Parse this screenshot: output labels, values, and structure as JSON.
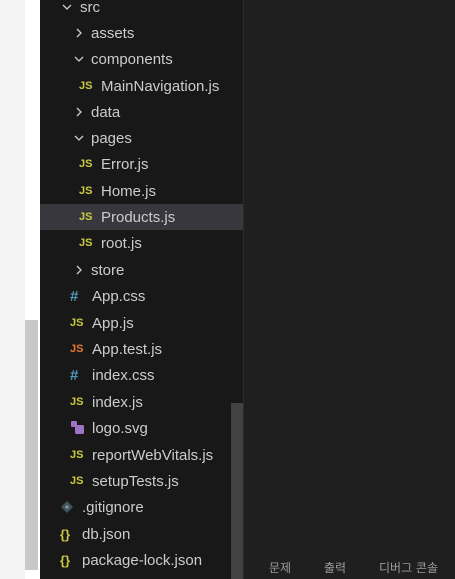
{
  "explorer": {
    "items": [
      {
        "label": "src",
        "type": "folder",
        "expanded": true,
        "icon": "chevron-down-icon"
      },
      {
        "label": "assets",
        "type": "folder",
        "expanded": false,
        "icon": "chevron-right-icon"
      },
      {
        "label": "components",
        "type": "folder",
        "expanded": true,
        "icon": "chevron-down-icon"
      },
      {
        "label": "MainNavigation.js",
        "type": "file",
        "icon_text": "JS"
      },
      {
        "label": "data",
        "type": "folder",
        "expanded": false,
        "icon": "chevron-right-icon"
      },
      {
        "label": "pages",
        "type": "folder",
        "expanded": true,
        "icon": "chevron-down-icon"
      },
      {
        "label": "Error.js",
        "type": "file",
        "icon_text": "JS"
      },
      {
        "label": "Home.js",
        "type": "file",
        "icon_text": "JS"
      },
      {
        "label": "Products.js",
        "type": "file",
        "icon_text": "JS",
        "selected": true
      },
      {
        "label": "root.js",
        "type": "file",
        "icon_text": "JS"
      },
      {
        "label": "store",
        "type": "folder",
        "expanded": false,
        "icon": "chevron-right-icon"
      },
      {
        "label": "App.css",
        "type": "file",
        "icon_text": "#"
      },
      {
        "label": "App.js",
        "type": "file",
        "icon_text": "JS"
      },
      {
        "label": "App.test.js",
        "type": "file",
        "icon_text": "JS"
      },
      {
        "label": "index.css",
        "type": "file",
        "icon_text": "#"
      },
      {
        "label": "index.js",
        "type": "file",
        "icon_text": "JS"
      },
      {
        "label": "logo.svg",
        "type": "file",
        "icon": "svg-file-icon"
      },
      {
        "label": "reportWebVitals.js",
        "type": "file",
        "icon_text": "JS"
      },
      {
        "label": "setupTests.js",
        "type": "file",
        "icon_text": "JS"
      },
      {
        "label": ".gitignore",
        "type": "file",
        "icon": "git-diamond-icon"
      },
      {
        "label": "db.json",
        "type": "file",
        "icon_text": "{}"
      },
      {
        "label": "package-lock.json",
        "type": "file",
        "icon_text": "{}"
      }
    ]
  },
  "panel": {
    "tabs": [
      "문제",
      "출력",
      "디버그 콘솔"
    ]
  },
  "colors": {
    "explorer_bg": "#181818",
    "editor_bg": "#1f1f1f",
    "selected_row": "#37373d",
    "js_icon": "#cbcb41",
    "test_icon": "#e37933",
    "css_icon": "#519aba",
    "svg_icon": "#a074c4"
  }
}
